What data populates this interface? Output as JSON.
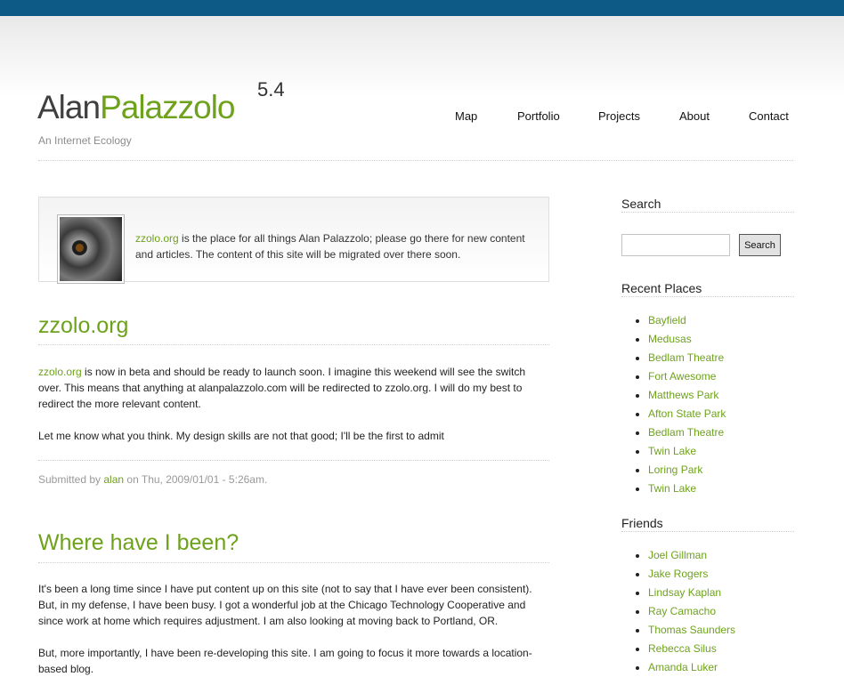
{
  "header": {
    "title_first": "Alan",
    "title_last": "Palazzolo",
    "version": "5.4",
    "tagline": "An Internet Ecology"
  },
  "nav": {
    "items": [
      {
        "label": "Map"
      },
      {
        "label": "Portfolio"
      },
      {
        "label": "Projects"
      },
      {
        "label": "About"
      },
      {
        "label": "Contact"
      }
    ]
  },
  "intro": {
    "link": "zzolo.org",
    "text": " is the place for all things Alan Palazzolo; please go there for new content and articles. The content of this site will be migrated over there soon."
  },
  "posts": [
    {
      "title": "zzolo.org",
      "p1_link": "zzolo.org",
      "p1_text": " is now in beta and should be ready to launch soon. I imagine this weekend will see the switch over. This means that anything at alanpalazzolo.com will be redirected to zzolo.org. I will do my best to redirect the more relevant content.",
      "p2": "Let me know what you think. My design skills are not that good; I'll be the first to admit",
      "meta_prefix": "Submitted by ",
      "meta_author": "alan",
      "meta_suffix": " on Thu, 2009/01/01 - 5:26am."
    },
    {
      "title": "Where have I been?",
      "p1": "It's been a long time since I have put content up on this site (not to say that I have ever been consistent). But, in my defense, I have been busy. I got a wonderful job at the Chicago Technology Cooperative and since work at home which requires adjustment. I am also looking at moving back to Portland, OR.",
      "p2": "But, more importantly, I have been re-developing this site. I am going to focus it more towards a location-based blog."
    }
  ],
  "sidebar": {
    "search_heading": "Search",
    "search_value": "",
    "search_button": "Search",
    "recent_heading": "Recent Places",
    "recent": [
      "Bayfield",
      "Medusas",
      "Bedlam Theatre",
      "Fort Awesome",
      "Matthews Park",
      "Afton State Park",
      "Bedlam Theatre",
      "Twin Lake",
      "Loring Park",
      "Twin Lake"
    ],
    "friends_heading": "Friends",
    "friends": [
      "Joel Gillman",
      "Jake Rogers",
      "Lindsay Kaplan",
      "Ray Camacho",
      "Thomas Saunders",
      "Rebecca Silus",
      "Amanda Luker"
    ]
  },
  "colors": {
    "accent": "#6ea21c",
    "topbar": "#0d5a86"
  }
}
